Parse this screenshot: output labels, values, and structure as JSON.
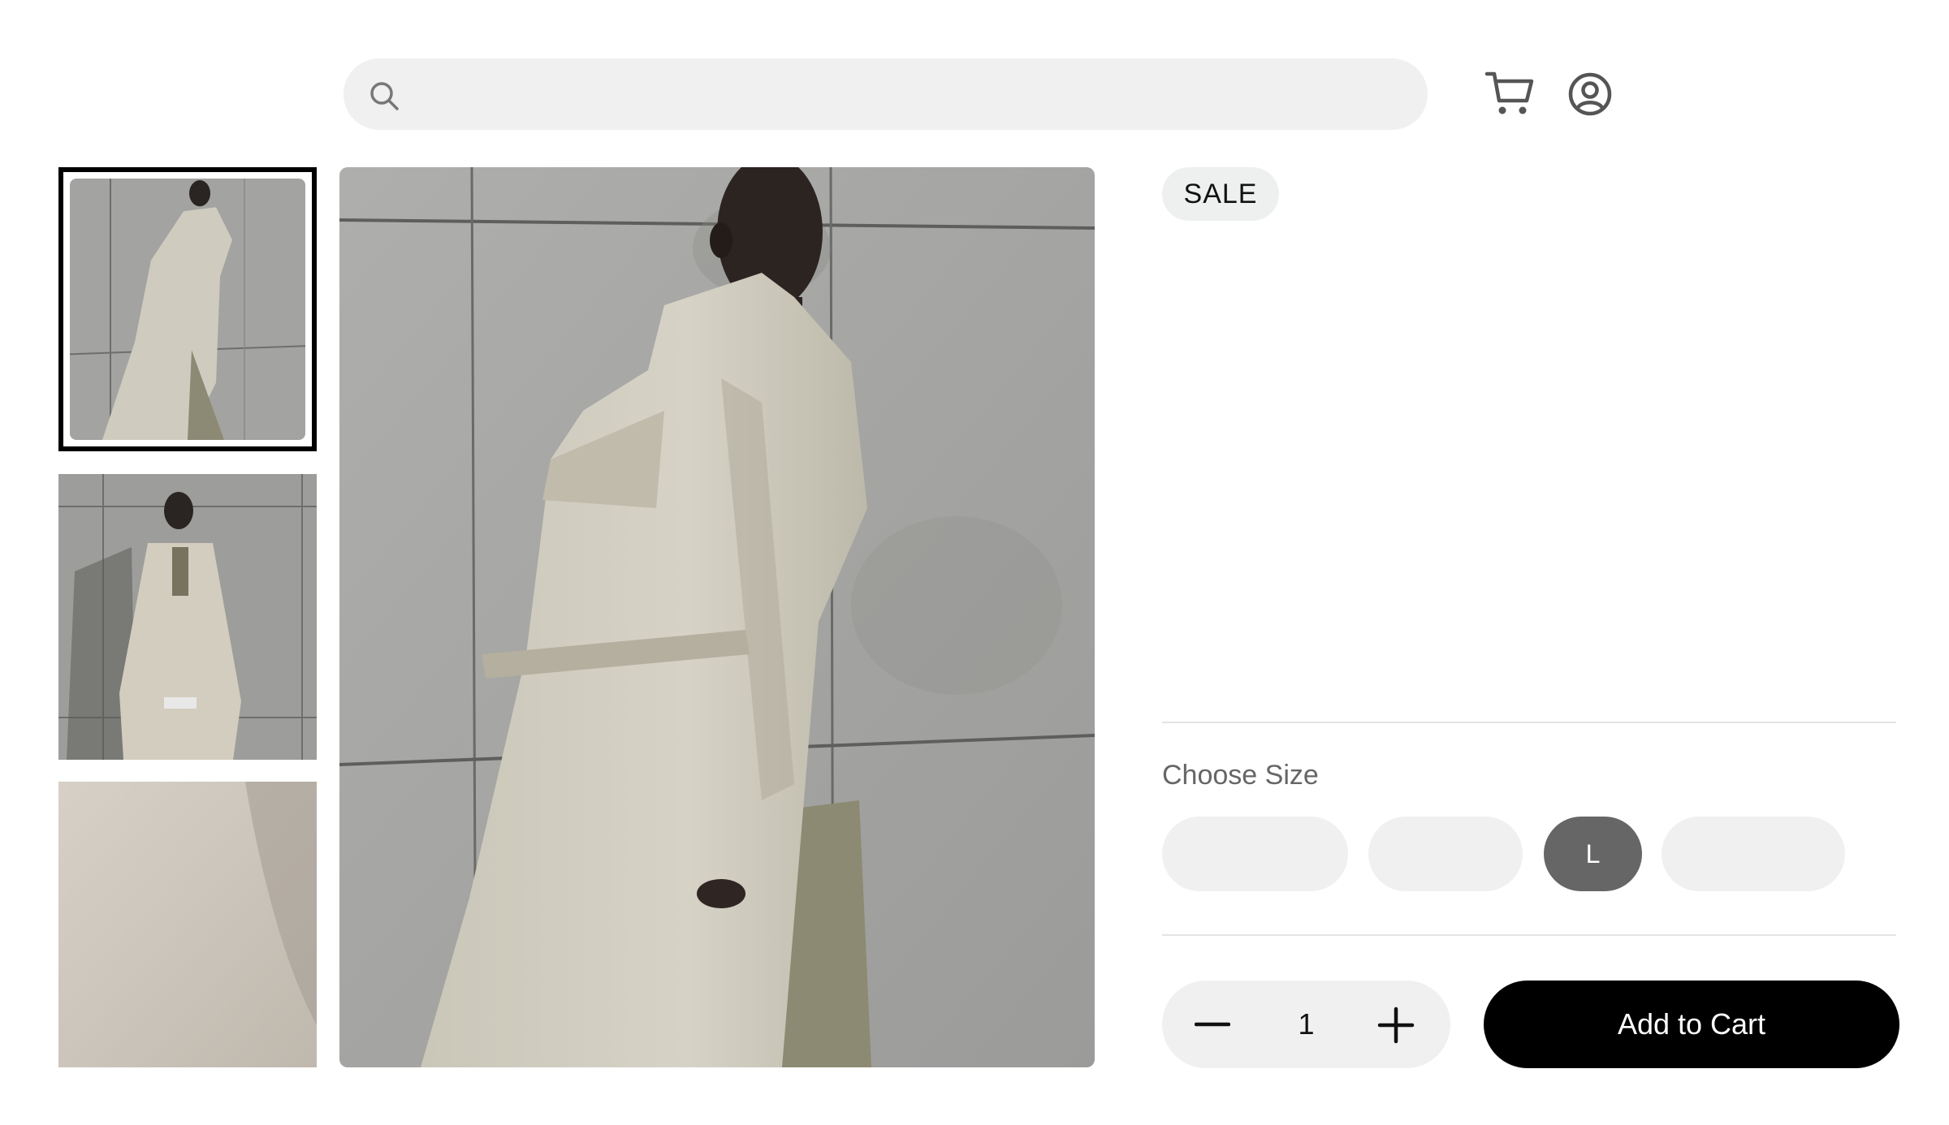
{
  "header": {
    "search": {
      "placeholder": "",
      "value": ""
    },
    "icons": [
      "search-icon",
      "cart-icon",
      "account-icon"
    ]
  },
  "gallery": {
    "thumbnails": [
      {
        "name": "thumbnail-1",
        "selected": true
      },
      {
        "name": "thumbnail-2",
        "selected": false
      },
      {
        "name": "thumbnail-3",
        "selected": false
      }
    ]
  },
  "product": {
    "badge": "SALE",
    "size": {
      "label": "Choose Size",
      "options": [
        "",
        "",
        "L",
        ""
      ],
      "selected": "L"
    },
    "quantity": {
      "value": "1"
    },
    "add_to_cart_label": "Add to Cart"
  },
  "colors": {
    "accent": "#000000",
    "selected_size": "#666666",
    "pill_bg": "#f0f0f0"
  }
}
